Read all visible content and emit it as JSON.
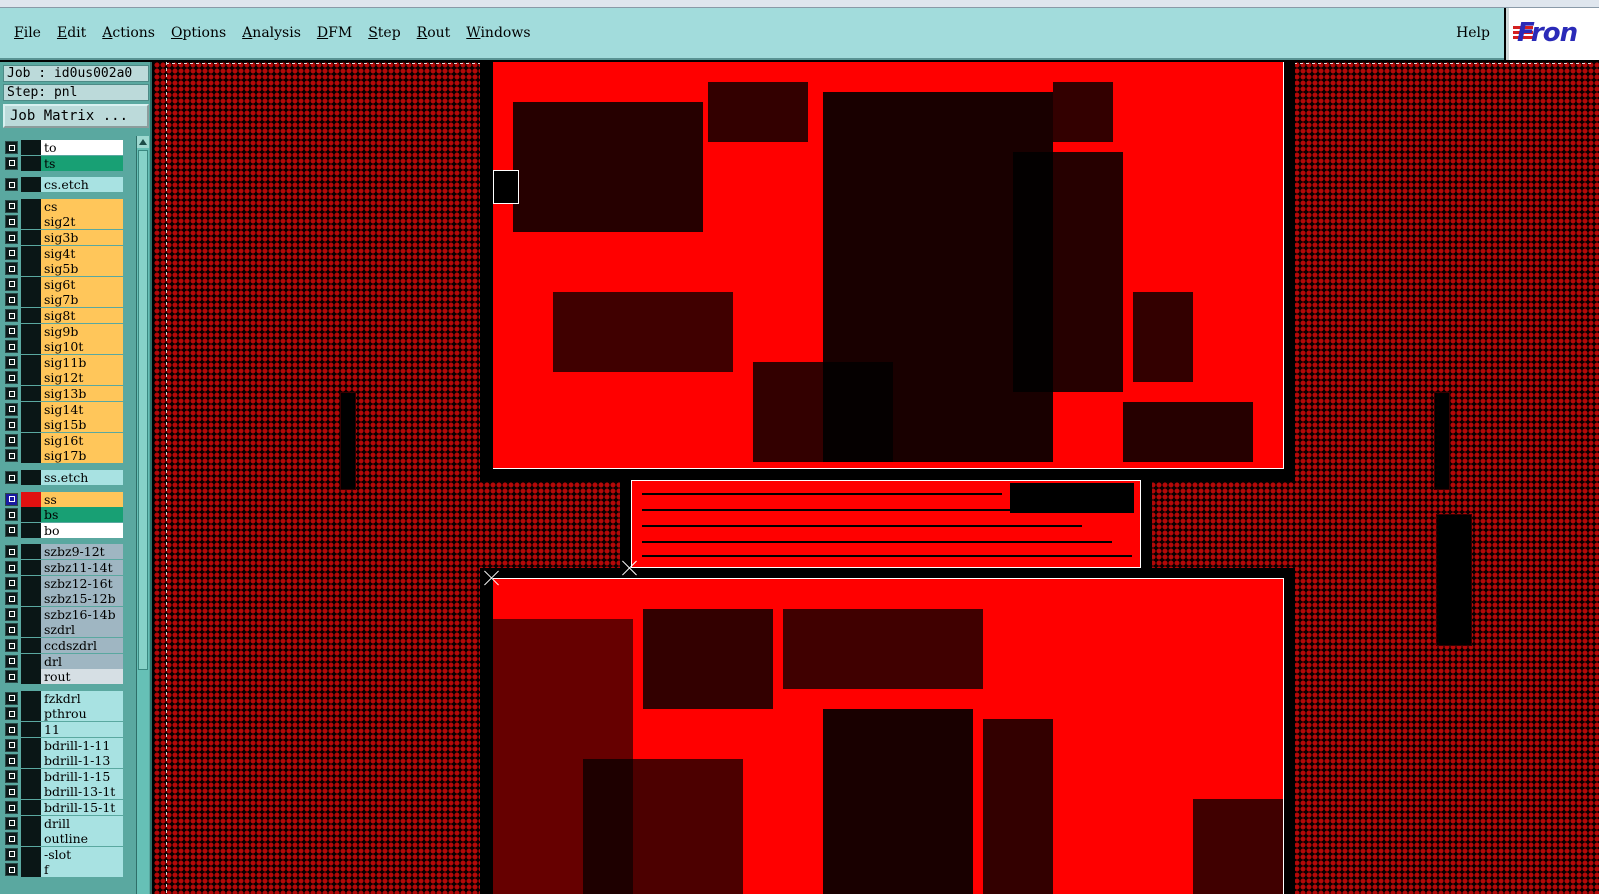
{
  "menubar": {
    "items": [
      "File",
      "Edit",
      "Actions",
      "Options",
      "Analysis",
      "DFM",
      "Step",
      "Rout",
      "Windows"
    ],
    "help": "Help",
    "logo": "Fron"
  },
  "sidebar": {
    "job": "Job : id0us002a0",
    "step": "Step: pnl",
    "job_matrix": "Job Matrix ...",
    "layers": [
      {
        "name": "to",
        "color": "#ffffff"
      },
      {
        "name": "ts",
        "color": "#18a074"
      },
      {
        "name": "cs.etch",
        "color": "#a8e2e2"
      },
      {
        "name": "cs",
        "color": "#ffc65a"
      },
      {
        "name": "sig2t",
        "color": "#ffc65a"
      },
      {
        "name": "sig3b",
        "color": "#ffc65a"
      },
      {
        "name": "sig4t",
        "color": "#ffc65a"
      },
      {
        "name": "sig5b",
        "color": "#ffc65a"
      },
      {
        "name": "sig6t",
        "color": "#ffc65a"
      },
      {
        "name": "sig7b",
        "color": "#ffc65a"
      },
      {
        "name": "sig8t",
        "color": "#ffc65a"
      },
      {
        "name": "sig9b",
        "color": "#ffc65a"
      },
      {
        "name": "sig10t",
        "color": "#ffc65a"
      },
      {
        "name": "sig11b",
        "color": "#ffc65a"
      },
      {
        "name": "sig12t",
        "color": "#ffc65a"
      },
      {
        "name": "sig13b",
        "color": "#ffc65a"
      },
      {
        "name": "sig14t",
        "color": "#ffc65a"
      },
      {
        "name": "sig15b",
        "color": "#ffc65a"
      },
      {
        "name": "sig16t",
        "color": "#ffc65a"
      },
      {
        "name": "sig17b",
        "color": "#ffc65a"
      },
      {
        "name": "ss.etch",
        "color": "#a8e2e2"
      },
      {
        "name": "ss",
        "color": "#ffc65a",
        "active": true
      },
      {
        "name": "bs",
        "color": "#18a074"
      },
      {
        "name": "bo",
        "color": "#ffffff"
      },
      {
        "name": "szbz9-12t",
        "color": "#9fb6c2"
      },
      {
        "name": "szbz11-14t",
        "color": "#9fb6c2"
      },
      {
        "name": "szbz12-16t",
        "color": "#9fb6c2"
      },
      {
        "name": "szbz15-12b",
        "color": "#9fb6c2"
      },
      {
        "name": "szbz16-14b",
        "color": "#9fb6c2"
      },
      {
        "name": "szdrl",
        "color": "#9fb6c2"
      },
      {
        "name": "ccdszdrl",
        "color": "#9fb6c2"
      },
      {
        "name": "drl",
        "color": "#9fb6c2"
      },
      {
        "name": "rout",
        "color": "#d6dfe4"
      },
      {
        "name": "fzkdrl",
        "color": "#a8e2e2"
      },
      {
        "name": "pthrou",
        "color": "#a8e2e2"
      },
      {
        "name": "11",
        "color": "#a8e2e2"
      },
      {
        "name": "bdrill-1-11",
        "color": "#a8e2e2"
      },
      {
        "name": "bdrill-1-13",
        "color": "#a8e2e2"
      },
      {
        "name": "bdrill-1-15",
        "color": "#a8e2e2"
      },
      {
        "name": "bdrill-13-1t",
        "color": "#a8e2e2"
      },
      {
        "name": "bdrill-15-1t",
        "color": "#a8e2e2"
      },
      {
        "name": "drill",
        "color": "#a8e2e2"
      },
      {
        "name": "outline",
        "color": "#a8e2e2"
      },
      {
        "name": "-slot",
        "color": "#a8e2e2"
      },
      {
        "name": "f",
        "color": "#a8e2e2"
      }
    ]
  },
  "colors": {
    "menubar": "#a2dcdc",
    "sidebar": "#5aa8a0",
    "copper": "#ff0000"
  }
}
